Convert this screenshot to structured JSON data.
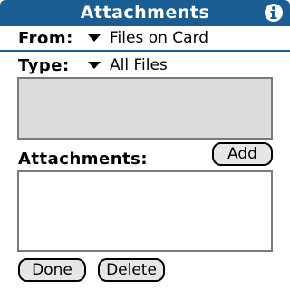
{
  "header": {
    "title": "Attachments",
    "info_icon": "info-icon",
    "bar_color": "#1a5d92"
  },
  "from": {
    "label": "From:",
    "value": "Files on Card"
  },
  "type": {
    "label": "Type:",
    "value": "All Files"
  },
  "files_list": {
    "items": []
  },
  "attachments": {
    "label": "Attachments:",
    "add_label": "Add",
    "items": []
  },
  "footer": {
    "done_label": "Done",
    "delete_label": "Delete"
  }
}
